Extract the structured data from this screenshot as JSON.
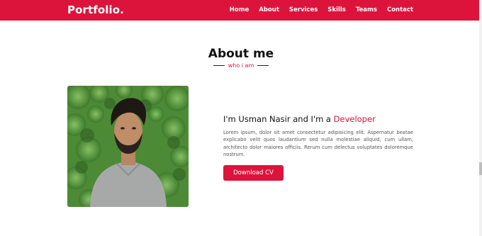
{
  "navbar": {
    "brand": "Portfolio.",
    "links": [
      "Home",
      "About",
      "Services",
      "Skills",
      "Teams",
      "Contact"
    ]
  },
  "about": {
    "title": "About me",
    "subtitle": "who i am",
    "intro_prefix": "I'm Usman Nasir and I'm a ",
    "intro_role": "Developer",
    "bio": "Lorem ipsum, dolor sit amet consectetur adipisicing elit. Aspernatur beatae explicabo velit quos laudantium sed nulla molestiae aliquid, cum ullam, architecto dolor maiores officiis. Rerum cum delectus voluptates doloremque nostrum.",
    "cv_button": "Download CV"
  },
  "colors": {
    "accent": "#dc143c",
    "background": "#ffffff",
    "text": "#111111",
    "muted_text": "#555555"
  },
  "icons": {
    "photo": "profile-photo"
  }
}
